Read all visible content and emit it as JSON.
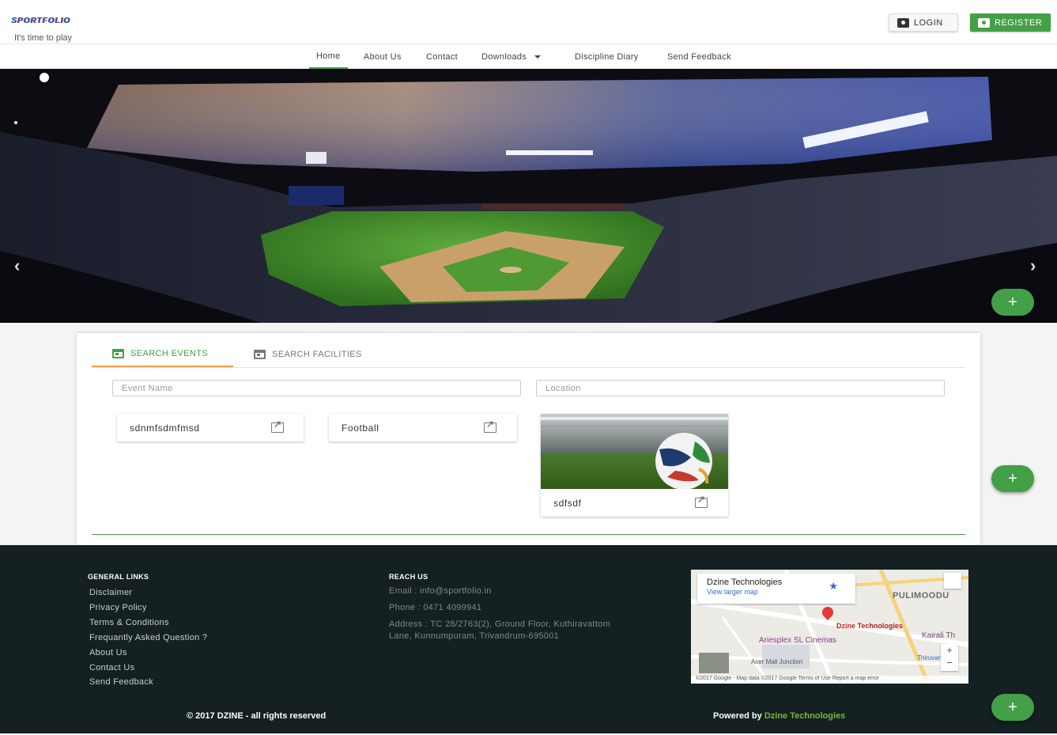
{
  "header": {
    "logo_text": "SPORTFOLIO",
    "tagline": "It's time to play",
    "login_label": "LOGIN",
    "register_label": "REGISTER"
  },
  "nav": {
    "items": [
      {
        "label": "Home",
        "active": true
      },
      {
        "label": "About Us"
      },
      {
        "label": "Contact"
      },
      {
        "label": "Downloads",
        "dropdown": true
      },
      {
        "label": "Discipline Diary"
      },
      {
        "label": "Send Feedback"
      }
    ]
  },
  "hero": {
    "prev_icon": "chevron-left-icon",
    "next_icon": "chevron-right-icon"
  },
  "fab": {
    "label": "+"
  },
  "search": {
    "tabs": [
      {
        "label": "SEARCH EVENTS",
        "active": true,
        "icon": "calendar-icon"
      },
      {
        "label": "SEARCH FACILITIES",
        "active": false,
        "icon": "calendar-icon"
      }
    ],
    "event_name_placeholder": "Event Name",
    "location_placeholder": "Location"
  },
  "events": [
    {
      "name": "sdnmfsdmfmsd"
    },
    {
      "name": "Football"
    },
    {
      "name": "sdfsdf",
      "has_image": true
    }
  ],
  "footer": {
    "general_links_heading": "GENERAL LINKS",
    "general_links": [
      "Disclaimer",
      "Privacy Policy",
      "Terms & Conditions",
      "Frequantly Asked Question ?",
      "About Us",
      "Contact Us",
      "Send Feedback"
    ],
    "reach_us_heading": "REACH US",
    "email": "Email : info@sportfolio.in",
    "phone": "Phone : 0471 4099941",
    "address_line1": "Address : TC 28/2763(2), Ground Floor, Kuthiravattom",
    "address_line2": "Lane, Kunnumpuram, Trivandrum-695001",
    "map": {
      "place_title": "Dzine Technologies",
      "view_larger": "View larger map",
      "pin_label": "Dzine Technologies",
      "labels": [
        "PULIMOODU",
        "Ariesplex SL Cinemas",
        "Kairali Th",
        "Acer Mall Junction",
        "Thiruvan"
      ],
      "zoom_in": "+",
      "zoom_out": "−",
      "attribution": "©2017 Google - Map data ©2017 Google   Terms of Use   Report a map error"
    },
    "copyright": "© 2017 DZINE - all rights reserved",
    "powered_by": "Powered by",
    "powered_company": "Dzine Technologies"
  },
  "colors": {
    "accent": "#43a047",
    "footer_bg": "#142021",
    "tab_underline": "#f0a24a"
  }
}
